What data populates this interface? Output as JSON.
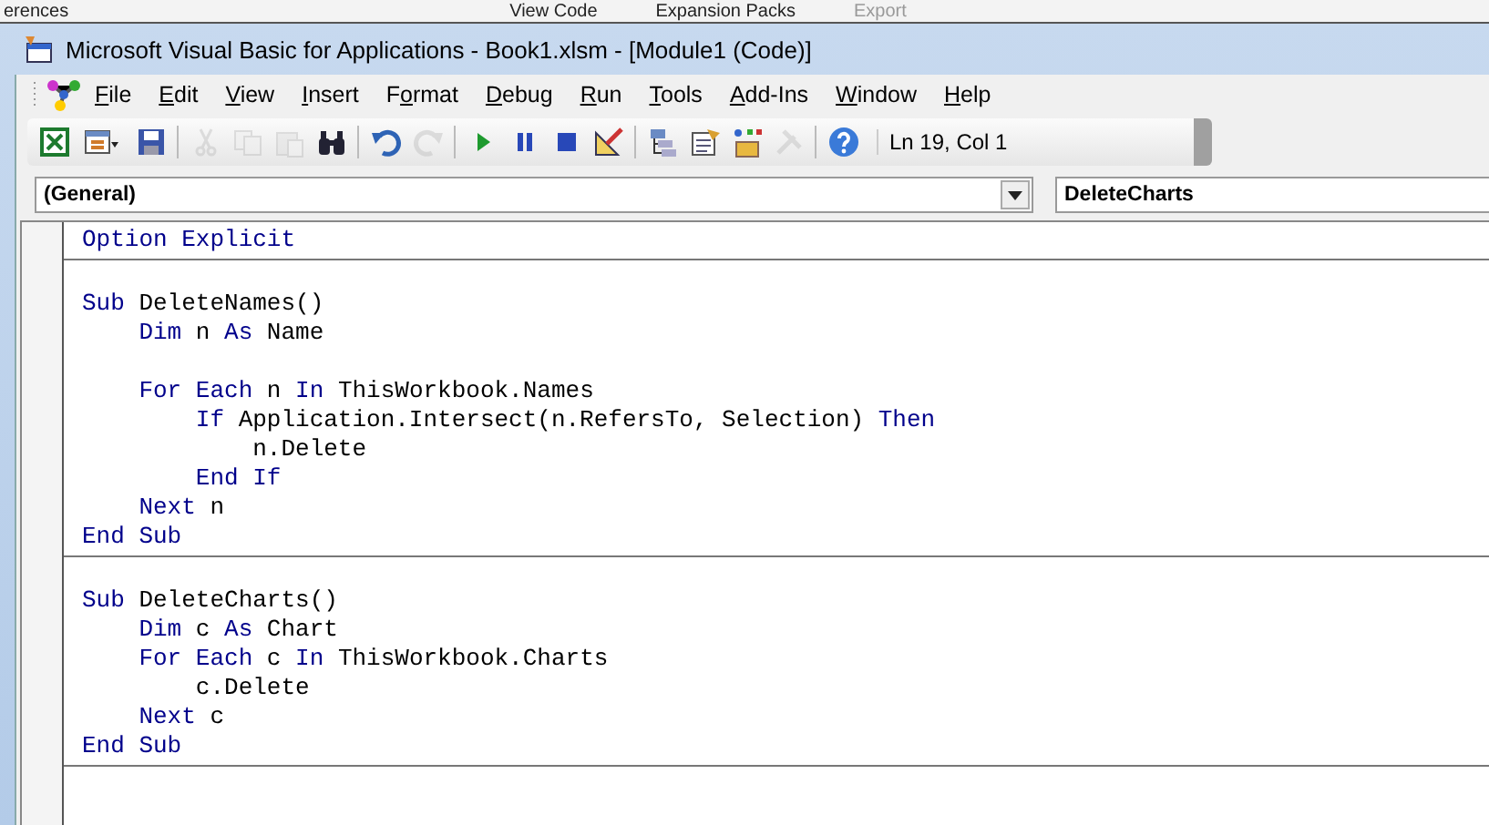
{
  "background_ribbon": [
    {
      "label": "erences",
      "disabled": false
    },
    {
      "label": "View Code",
      "disabled": false
    },
    {
      "label": "Expansion Packs",
      "disabled": false
    },
    {
      "label": "Export",
      "disabled": true
    }
  ],
  "window": {
    "title": "Microsoft Visual Basic for Applications - Book1.xlsm - [Module1 (Code)]"
  },
  "menu": [
    {
      "access_key": "F",
      "rest": "ile"
    },
    {
      "access_key": "E",
      "rest": "dit"
    },
    {
      "access_key": "V",
      "rest": "iew"
    },
    {
      "access_key": "I",
      "rest": "nsert"
    },
    {
      "lead": "F",
      "access_key": "o",
      "rest": "rmat"
    },
    {
      "access_key": "D",
      "rest": "ebug"
    },
    {
      "access_key": "R",
      "rest": "un"
    },
    {
      "access_key": "T",
      "rest": "ools"
    },
    {
      "access_key": "A",
      "rest": "dd-Ins"
    },
    {
      "access_key": "W",
      "rest": "indow"
    },
    {
      "access_key": "H",
      "rest": "elp"
    }
  ],
  "toolbar": {
    "buttons": [
      {
        "kind": "excel",
        "disabled": false
      },
      {
        "kind": "insert",
        "disabled": false
      },
      {
        "kind": "save",
        "disabled": false
      },
      {
        "kind": "sep"
      },
      {
        "kind": "cut",
        "disabled": true
      },
      {
        "kind": "copy",
        "disabled": true
      },
      {
        "kind": "paste",
        "disabled": true
      },
      {
        "kind": "find",
        "disabled": false
      },
      {
        "kind": "sep"
      },
      {
        "kind": "undo",
        "disabled": false
      },
      {
        "kind": "redo",
        "disabled": true
      },
      {
        "kind": "sep"
      },
      {
        "kind": "run",
        "disabled": false
      },
      {
        "kind": "break",
        "disabled": false
      },
      {
        "kind": "reset",
        "disabled": false
      },
      {
        "kind": "design",
        "disabled": false
      },
      {
        "kind": "sep"
      },
      {
        "kind": "project",
        "disabled": false
      },
      {
        "kind": "properties",
        "disabled": false
      },
      {
        "kind": "browser",
        "disabled": false
      },
      {
        "kind": "toolbox",
        "disabled": true
      },
      {
        "kind": "sep"
      },
      {
        "kind": "help",
        "disabled": false
      }
    ],
    "position": "Ln 19, Col 1"
  },
  "object_combo": {
    "value": "(General)"
  },
  "procedure_combo": {
    "value": "DeleteCharts"
  },
  "code": {
    "sections": [
      {
        "lines": [
          {
            "kind": "code",
            "tokens": [
              {
                "text": "Option Explicit",
                "kind": "keyword"
              }
            ]
          }
        ]
      },
      {
        "lines": [
          {
            "kind": "blank"
          },
          {
            "kind": "code",
            "tokens": [
              {
                "text": "Sub",
                "kind": "keyword"
              },
              {
                "text": " DeleteNames()",
                "kind": "plain"
              }
            ]
          },
          {
            "kind": "code",
            "tokens": [
              {
                "text": "    Dim",
                "kind": "keyword"
              },
              {
                "text": " n ",
                "kind": "plain"
              },
              {
                "text": "As",
                "kind": "keyword"
              },
              {
                "text": " Name",
                "kind": "plain"
              }
            ]
          },
          {
            "kind": "blank"
          },
          {
            "kind": "code",
            "tokens": [
              {
                "text": "    For Each",
                "kind": "keyword"
              },
              {
                "text": " n ",
                "kind": "plain"
              },
              {
                "text": "In",
                "kind": "keyword"
              },
              {
                "text": " ThisWorkbook.Names",
                "kind": "plain"
              }
            ]
          },
          {
            "kind": "code",
            "tokens": [
              {
                "text": "        If",
                "kind": "keyword"
              },
              {
                "text": " Application.Intersect(n.RefersTo, Selection) ",
                "kind": "plain"
              },
              {
                "text": "Then",
                "kind": "keyword"
              }
            ]
          },
          {
            "kind": "code",
            "tokens": [
              {
                "text": "            n.Delete",
                "kind": "plain"
              }
            ]
          },
          {
            "kind": "code",
            "tokens": [
              {
                "text": "        End If",
                "kind": "keyword"
              }
            ]
          },
          {
            "kind": "code",
            "tokens": [
              {
                "text": "    Next",
                "kind": "keyword"
              },
              {
                "text": " n",
                "kind": "plain"
              }
            ]
          },
          {
            "kind": "code",
            "tokens": [
              {
                "text": "End Sub",
                "kind": "keyword"
              }
            ]
          }
        ]
      },
      {
        "lines": [
          {
            "kind": "blank"
          },
          {
            "kind": "code",
            "tokens": [
              {
                "text": "Sub",
                "kind": "keyword"
              },
              {
                "text": " DeleteCharts()",
                "kind": "plain"
              }
            ]
          },
          {
            "kind": "code",
            "tokens": [
              {
                "text": "    Dim",
                "kind": "keyword"
              },
              {
                "text": " c ",
                "kind": "plain"
              },
              {
                "text": "As",
                "kind": "keyword"
              },
              {
                "text": " Chart",
                "kind": "plain"
              }
            ]
          },
          {
            "kind": "code",
            "tokens": [
              {
                "text": "    For Each",
                "kind": "keyword"
              },
              {
                "text": " c ",
                "kind": "plain"
              },
              {
                "text": "In",
                "kind": "keyword"
              },
              {
                "text": " ThisWorkbook.Charts",
                "kind": "plain"
              }
            ]
          },
          {
            "kind": "code",
            "tokens": [
              {
                "text": "        c.Delete",
                "kind": "plain"
              }
            ]
          },
          {
            "kind": "code",
            "tokens": [
              {
                "text": "    Next",
                "kind": "keyword"
              },
              {
                "text": " c",
                "kind": "plain"
              }
            ]
          },
          {
            "kind": "code",
            "tokens": [
              {
                "text": "End Sub",
                "kind": "keyword"
              }
            ]
          }
        ]
      }
    ]
  }
}
